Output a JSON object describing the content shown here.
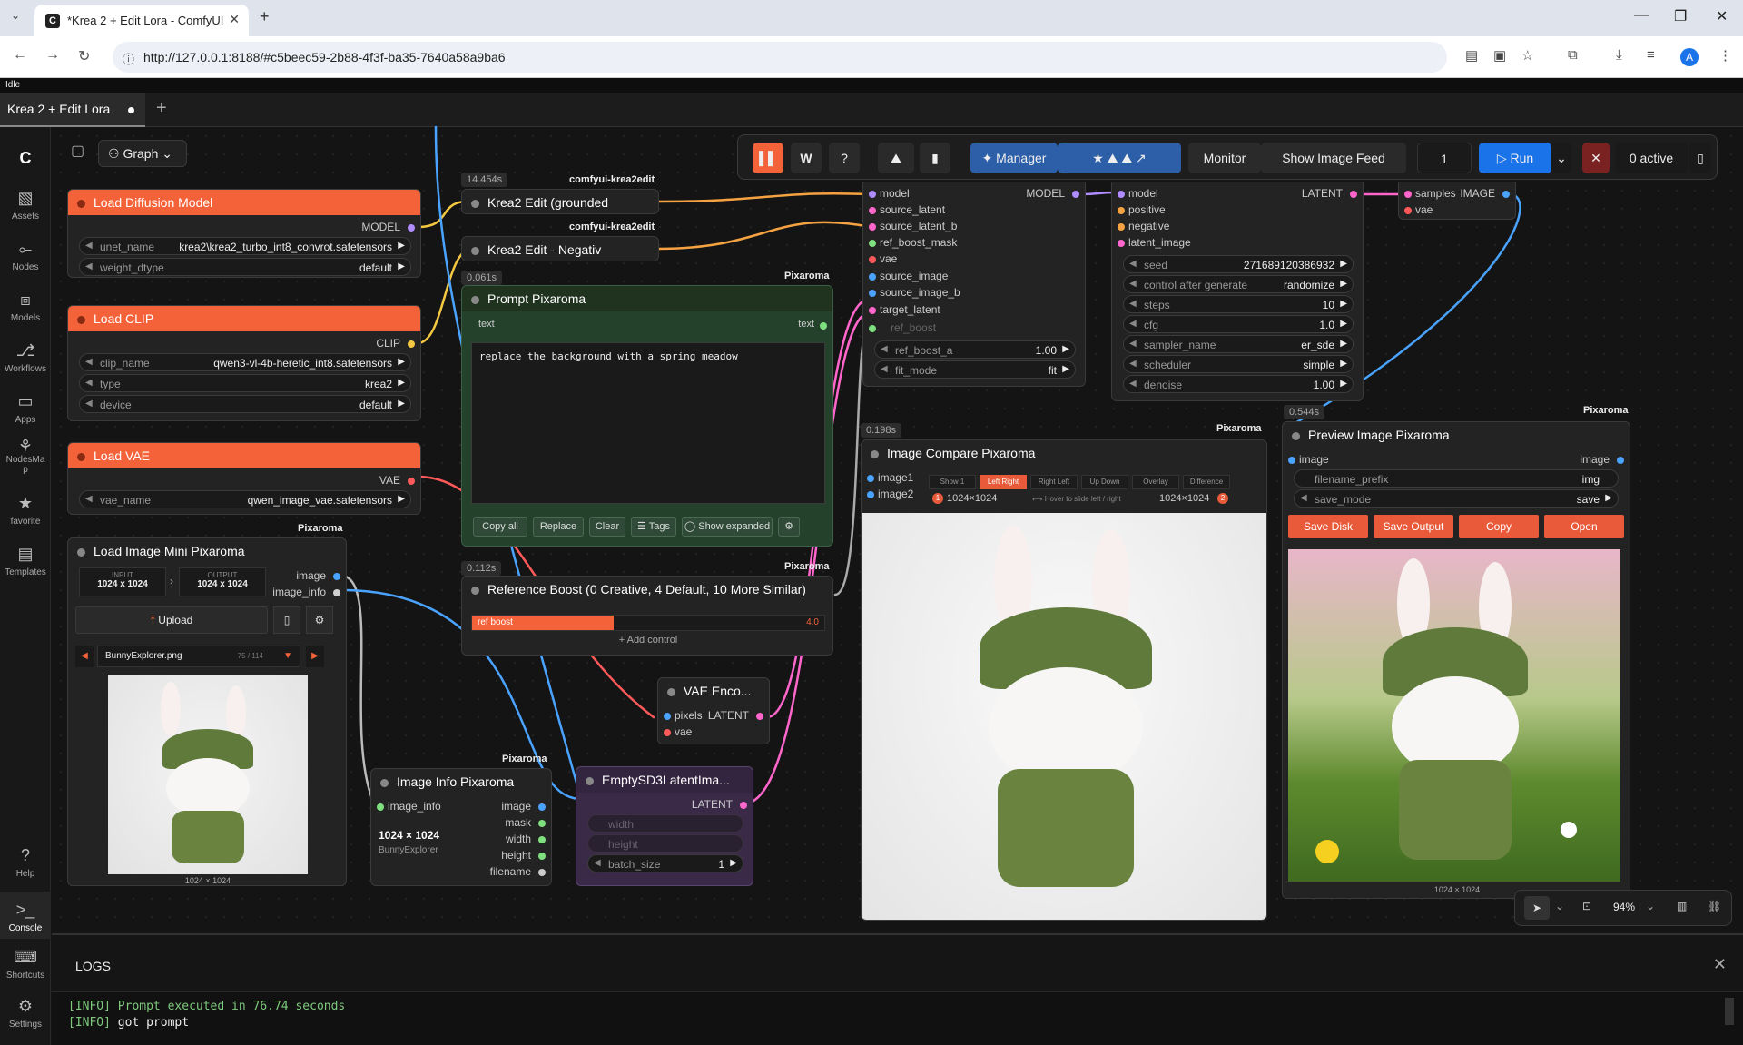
{
  "browser": {
    "tab_title": "*Krea 2 + Edit Lora - ComfyUI",
    "url": "http://127.0.0.1:8188/#c5beec59-2b88-4f3f-ba35-7640a58a9ba6",
    "avatar": "A"
  },
  "status": "Idle",
  "workflow_tab": "Krea 2 + Edit Lora",
  "graph_label": "Graph",
  "sidebar": {
    "items": [
      {
        "label": "Assets",
        "icon": "assets-icon"
      },
      {
        "label": "Nodes",
        "icon": "nodes-icon"
      },
      {
        "label": "Models",
        "icon": "models-icon"
      },
      {
        "label": "Workflows",
        "icon": "workflows-icon"
      },
      {
        "label": "Apps",
        "icon": "apps-icon"
      },
      {
        "label": "NodesMa\np",
        "icon": "nodes-map-icon"
      },
      {
        "label": "favorite",
        "icon": "star-icon"
      },
      {
        "label": "Templates",
        "icon": "templates-icon"
      }
    ],
    "bottom": [
      {
        "label": "Help"
      },
      {
        "label": "Console"
      },
      {
        "label": "Shortcuts"
      },
      {
        "label": "Settings"
      }
    ]
  },
  "toolbar": {
    "manager": "Manager",
    "monitor": "Monitor",
    "show_feed": "Show Image Feed",
    "queue_count": "1",
    "run": "Run",
    "active": "0 active"
  },
  "nodes": {
    "load_diffusion": {
      "title": "Load Diffusion Model",
      "out": "MODEL",
      "unet_label": "unet_name",
      "unet": "krea2\\krea2_turbo_int8_convrot.safetensors",
      "dtype_label": "weight_dtype",
      "dtype": "default"
    },
    "load_clip": {
      "title": "Load CLIP",
      "out": "CLIP",
      "clip_label": "clip_name",
      "clip": "qwen3-vl-4b-heretic_int8.safetensors",
      "type_label": "type",
      "type": "krea2",
      "device_label": "device",
      "device": "default"
    },
    "load_vae": {
      "title": "Load VAE",
      "out": "VAE",
      "vae_label": "vae_name",
      "vae": "qwen_image_vae.safetensors"
    },
    "krea_grounded": {
      "time": "14.454s",
      "tag": "comfyui-krea2edit",
      "title": "Krea2 Edit (grounded"
    },
    "krea_neg": {
      "tag": "comfyui-krea2edit",
      "title": "Krea2 Edit - Negativ"
    },
    "prompt": {
      "time": "0.061s",
      "tag": "Pixaroma",
      "title": "Prompt Pixaroma",
      "in": "text",
      "out": "text",
      "text": "replace the background with a spring meadow",
      "b_copy": "Copy all",
      "b_replace": "Replace",
      "b_clear": "Clear",
      "b_tags": "☰ Tags",
      "b_expand": "◯ Show expanded"
    },
    "refboost": {
      "time": "0.112s",
      "tag": "Pixaroma",
      "title": "Reference Boost (0 Creative, 4 Default, 10 More Similar)",
      "bar_label": "ref boost",
      "bar_val": "4.0",
      "bar_fraction": 0.4,
      "add": "+ Add control"
    },
    "load_image": {
      "tag": "Pixaroma",
      "title": "Load Image Mini Pixaroma",
      "in_label": "INPUT",
      "in_val": "1024 x 1024",
      "out_label": "OUTPUT",
      "out_val": "1024 x 1024",
      "o1": "image",
      "o2": "image_info",
      "upload": "Upload",
      "file": "BunnyExplorer.png",
      "idx": "75 / 114",
      "size": "1024 × 1024"
    },
    "image_info": {
      "tag": "Pixaroma",
      "title": "Image Info Pixaroma",
      "in": "image_info",
      "o1": "image",
      "o2": "mask",
      "o3": "width",
      "o4": "height",
      "o5": "filename",
      "dims": "1024 × 1024",
      "name": "BunnyExplorer"
    },
    "vae_encode": {
      "title": "VAE Enco...",
      "i1": "pixels",
      "i2": "vae",
      "out": "LATENT"
    },
    "empty_latent": {
      "title": "EmptySD3LatentIma...",
      "out": "LATENT",
      "w": "width",
      "h": "height",
      "bs_label": "batch_size",
      "bs": "1"
    },
    "krea_node": {
      "i1": "model",
      "i2": "source_latent",
      "i3": "source_latent_b",
      "i4": "ref_boost_mask",
      "i5": "vae",
      "i6": "source_image",
      "i7": "source_image_b",
      "i8": "target_latent",
      "i9": "ref_boost",
      "out": "MODEL",
      "w1_label": "ref_boost_a",
      "w1": "1.00",
      "w2_label": "fit_mode",
      "w2": "fit"
    },
    "ksampler": {
      "i1": "model",
      "i2": "positive",
      "i3": "negative",
      "i4": "latent_image",
      "out": "LATENT",
      "seed_label": "seed",
      "seed": "271689120386932",
      "cag_label": "control after generate",
      "cag": "randomize",
      "steps_label": "steps",
      "steps": "10",
      "cfg_label": "cfg",
      "cfg": "1.0",
      "sampler_label": "sampler_name",
      "sampler": "er_sde",
      "sched_label": "scheduler",
      "sched": "simple",
      "den_label": "denoise",
      "den": "1.00"
    },
    "decode": {
      "i1": "samples",
      "i2": "vae",
      "out": "IMAGE"
    },
    "compare": {
      "time": "0.198s",
      "tag": "Pixaroma",
      "title": "Image Compare Pixaroma",
      "i1": "image1",
      "i2": "image2",
      "tabs": [
        "Show 1",
        "Left Right",
        "Right Left",
        "Up Down",
        "Overlay",
        "Difference"
      ],
      "d1": "1024×1024",
      "hint": "⟷ Hover to slide left / right",
      "d2": "1024×1024",
      "n1": "1",
      "n2": "2"
    },
    "preview": {
      "time": "0.544s",
      "tag": "Pixaroma",
      "title": "Preview Image Pixaroma",
      "in": "image",
      "out": "image",
      "prefix_label": "filename_prefix",
      "prefix": "img",
      "mode_label": "save_mode",
      "mode": "save",
      "b1": "Save Disk",
      "b2": "Save Output",
      "b3": "Copy",
      "b4": "Open",
      "size": "1024 × 1024"
    }
  },
  "canvas_controls": {
    "zoom": "94%"
  },
  "logs": {
    "title": "LOGS",
    "l1_tag": "[INFO]",
    "l1": "Prompt executed in 76.74 seconds",
    "l2_tag": "[INFO]",
    "l2": "got prompt"
  }
}
